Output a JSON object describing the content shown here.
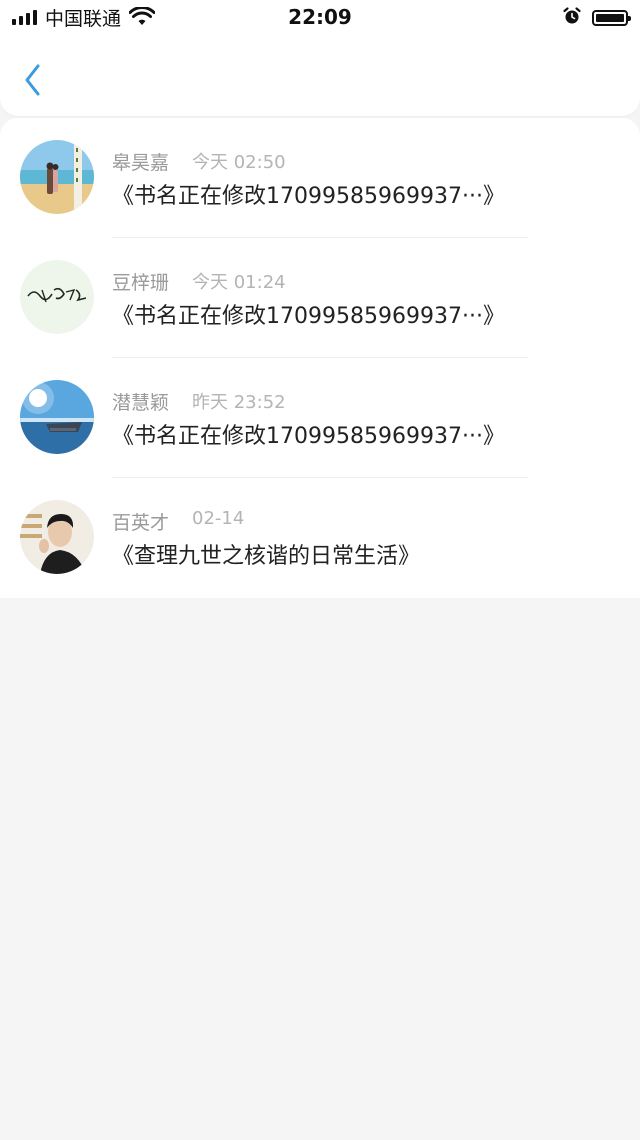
{
  "status_bar": {
    "carrier": "中国联通",
    "time": "22:09",
    "alarm_icon": "alarm-clock-icon",
    "wifi_icon": "wifi-icon",
    "battery_icon": "battery-icon"
  },
  "nav": {
    "back_icon": "chevron-left-icon",
    "accent_color": "#3a9be0"
  },
  "list": {
    "items": [
      {
        "name": "皋昊嘉",
        "time": "今天 02:50",
        "title": "《书名正在修改17099585969937···》",
        "avatar": "beach-couple-avatar"
      },
      {
        "name": "豆梓珊",
        "time": "今天 01:24",
        "title": "《书名正在修改17099585969937···》",
        "avatar": "calligraphy-avatar"
      },
      {
        "name": "潜慧颖",
        "time": "昨天 23:52",
        "title": "《书名正在修改17099585969937···》",
        "avatar": "sea-boat-avatar"
      },
      {
        "name": "百英才",
        "time": "02-14",
        "title": "《查理九世之核谐的日常生活》",
        "avatar": "portrait-avatar"
      }
    ]
  }
}
